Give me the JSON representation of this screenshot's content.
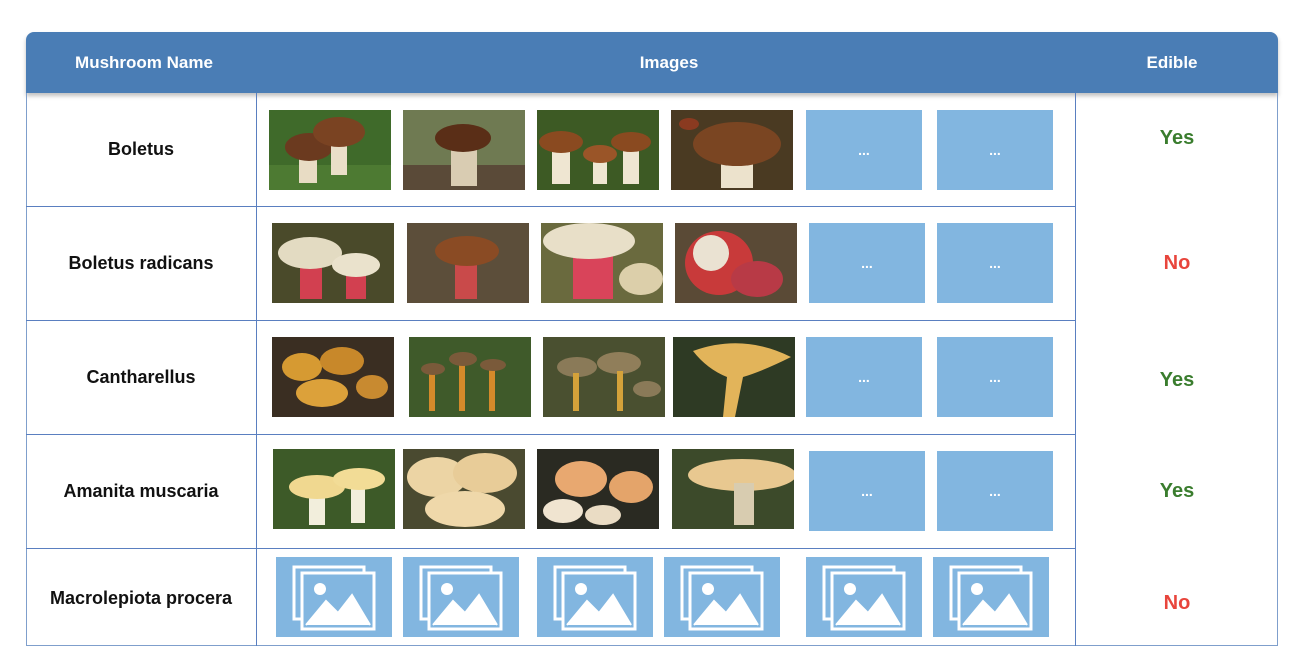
{
  "header": {
    "col_name": "Mushroom Name",
    "col_images": "Images",
    "col_edible": "Edible"
  },
  "colors": {
    "header_bg": "#4a7db5",
    "placeholder_bg": "#82b6e0",
    "yes": "#3a7d2e",
    "no": "#e8453c"
  },
  "rows": [
    {
      "name": "Boletus",
      "edible": "Yes",
      "more_1": "...",
      "more_2": "..."
    },
    {
      "name": "Boletus radicans",
      "edible": "No",
      "more_1": "...",
      "more_2": "..."
    },
    {
      "name": "Cantharellus",
      "edible": "Yes",
      "more_1": "...",
      "more_2": "..."
    },
    {
      "name": "Amanita muscaria",
      "edible": "Yes",
      "more_1": "...",
      "more_2": "..."
    },
    {
      "name": "Macrolepiota procera",
      "edible": "No"
    }
  ],
  "placeholder_icon": "image-placeholder-icon"
}
